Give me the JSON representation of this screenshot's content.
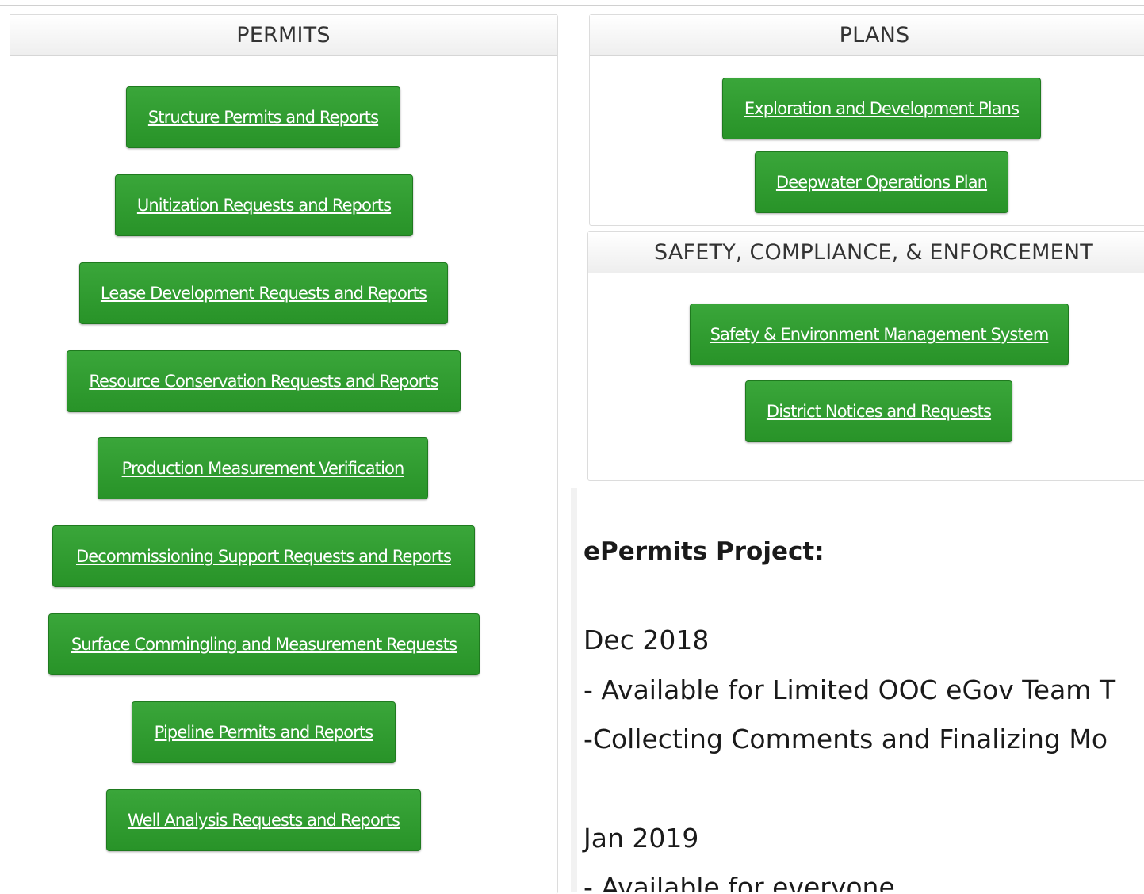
{
  "permits": {
    "title": "PERMITS",
    "buttons": [
      "Structure Permits and Reports",
      "Unitization Requests and Reports",
      "Lease Development Requests and Reports",
      "Resource Conservation Requests and Reports",
      "Production Measurement Verification",
      "Decommissioning Support Requests and Reports",
      "Surface Commingling and Measurement Requests",
      "Pipeline Permits and Reports",
      "Well Analysis Requests and Reports"
    ]
  },
  "plans": {
    "title": "PLANS",
    "buttons": [
      "Exploration and Development Plans",
      "Deepwater Operations Plan"
    ]
  },
  "safety": {
    "title": "SAFETY, COMPLIANCE, & ENFORCEMENT",
    "buttons": [
      "Safety & Environment Management System",
      "District Notices and Requests"
    ]
  },
  "news": {
    "title": "ePermits Project:",
    "lines": [
      "Dec 2018",
      "- Available for Limited OOC eGov Team T",
      "-Collecting Comments and Finalizing Mo",
      "Jan 2019",
      "- Available for everyone"
    ]
  },
  "colors": {
    "button_green": "#2e9b2e",
    "button_border": "#1f7a1f",
    "header_text": "#333333"
  }
}
